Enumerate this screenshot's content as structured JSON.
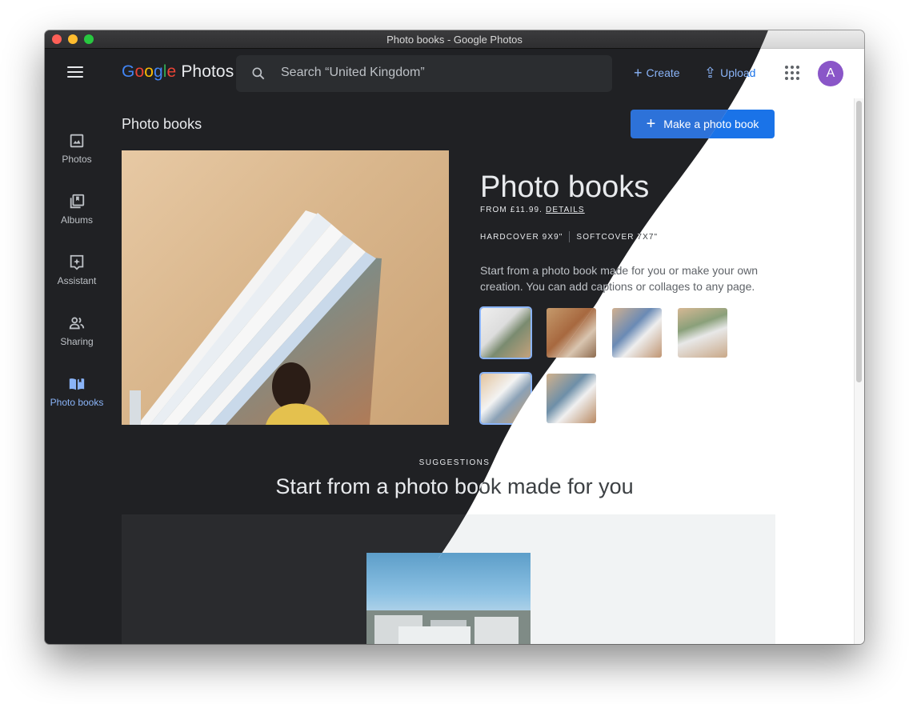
{
  "window": {
    "title": "Photo books - Google Photos"
  },
  "header": {
    "logo_word": "Google",
    "logo_product": "Photos",
    "search_placeholder": "Search “United Kingdom”",
    "create_label": "Create",
    "upload_label": "Upload",
    "avatar_initial": "A"
  },
  "sidebar": {
    "items": [
      {
        "label": "Photos",
        "icon": "photo-icon"
      },
      {
        "label": "Albums",
        "icon": "albums-icon"
      },
      {
        "label": "Assistant",
        "icon": "assistant-icon"
      },
      {
        "label": "Sharing",
        "icon": "people-icon"
      },
      {
        "label": "Photo books",
        "icon": "book-icon",
        "active": true
      }
    ]
  },
  "main": {
    "heading": "Photo books",
    "make_button_label": "Make a photo book",
    "product": {
      "title": "Photo books",
      "price_text": "FROM £11.99.",
      "details_link": "DETAILS",
      "cover_option_1": "HARDCOVER 9X9\"",
      "cover_option_2": "SOFTCOVER 7X7\"",
      "description": "Start from a photo book made for you or make your own creation. You can add captions or collages to any page."
    },
    "suggestions": {
      "label": "SUGGESTIONS",
      "title": "Start from a photo book made for you"
    }
  },
  "colors": {
    "dark_bg": "#202124",
    "accent_blue": "#8ab4f8",
    "button_blue": "#1a73e8",
    "avatar_purple": "#8a56c8"
  }
}
